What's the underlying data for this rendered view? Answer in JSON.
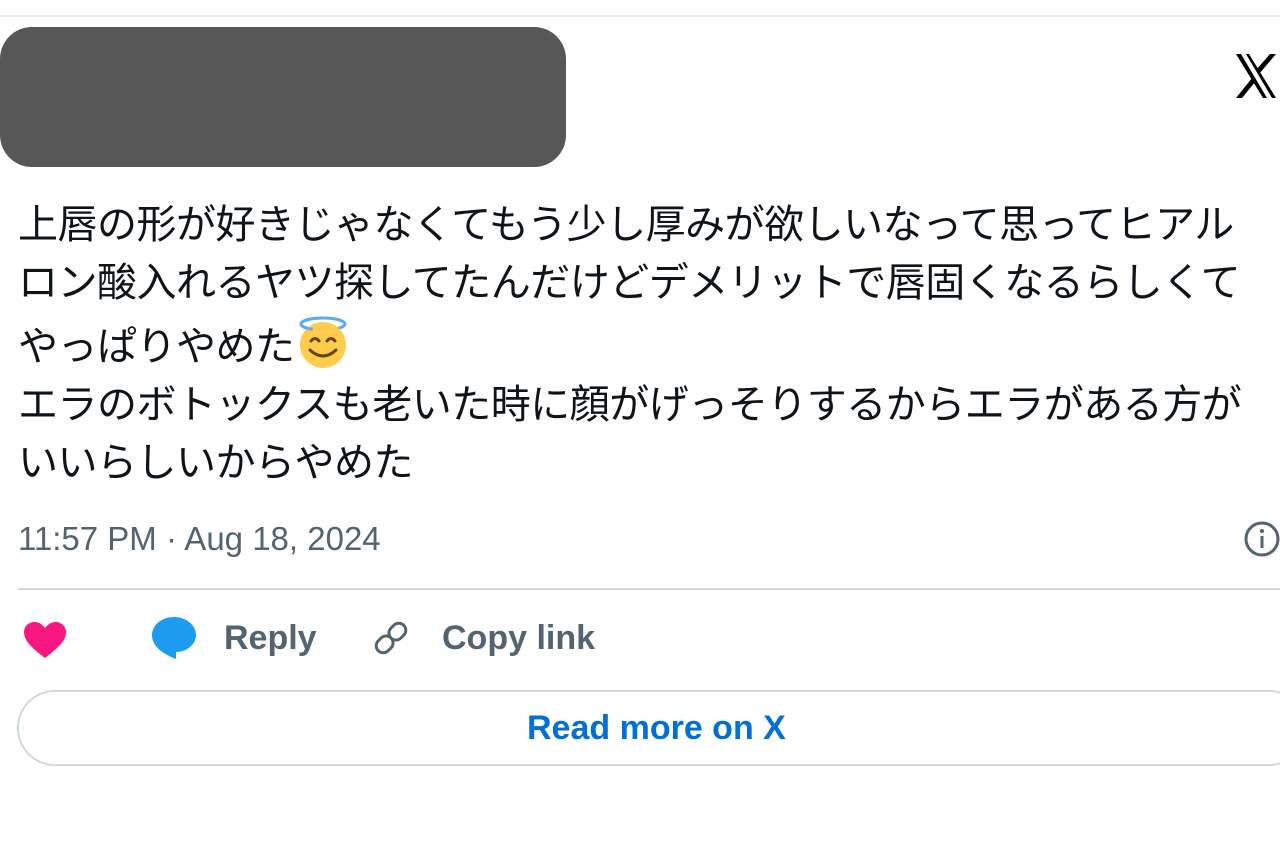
{
  "header": {
    "logo_icon": "x-logo-icon"
  },
  "tweet": {
    "text_part1": "上唇の形が好きじゃなくてもう少し厚みが欲しいなって思ってヒアルロン酸入れるヤツ探してたんだけどデメリットで唇固くなるらしくてやっぱりやめた",
    "emoji_icon": "smiling-face-with-halo-icon",
    "text_part2": "\nエラのボトックスも老いた時に顔がげっそりするからエラがある方がいいらしいからやめた",
    "timestamp": "11:57 PM · Aug 18, 2024",
    "info_icon": "info-circle-icon"
  },
  "actions": {
    "like_icon": "heart-icon",
    "reply_icon": "speech-bubble-icon",
    "reply_label": "Reply",
    "copy_icon": "link-icon",
    "copy_label": "Copy link"
  },
  "read_more": {
    "label": "Read more on X"
  },
  "colors": {
    "heart": "#f91880",
    "reply_bubble": "#1d9bf0",
    "link_text": "#006fd6",
    "muted_text": "#536471",
    "divider": "#cfd9de"
  }
}
